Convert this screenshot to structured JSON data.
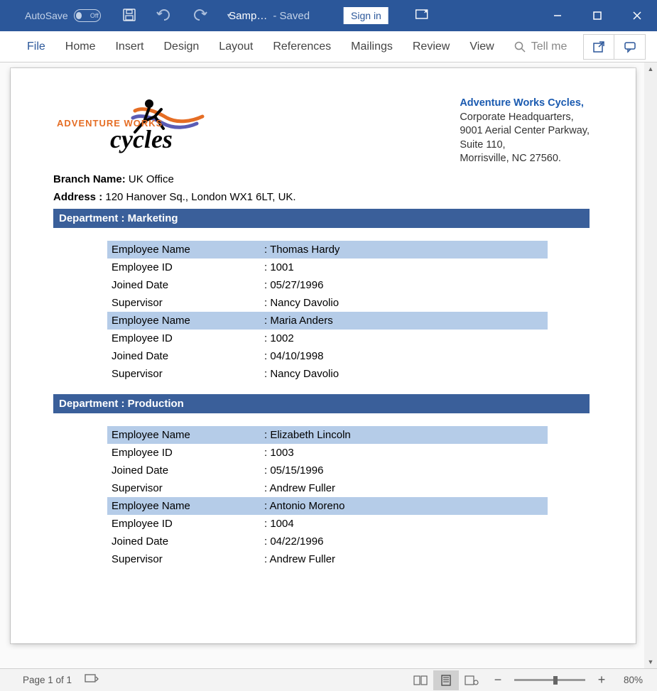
{
  "titlebar": {
    "autosave_label": "AutoSave",
    "autosave_toggle_text": "Off",
    "doc_title": "Samp…",
    "doc_status": "- Saved",
    "signin_label": "Sign in"
  },
  "ribbon": {
    "tabs": {
      "file": "File",
      "home": "Home",
      "insert": "Insert",
      "design": "Design",
      "layout": "Layout",
      "references": "References",
      "mailings": "Mailings",
      "review": "Review",
      "view": "View"
    },
    "tellme_placeholder": "Tell me"
  },
  "document": {
    "company_name": "Adventure Works Cycles,",
    "hq_line1": "Corporate Headquarters,",
    "hq_line2": "9001 Aerial Center Parkway,",
    "hq_line3": "Suite 110,",
    "hq_line4": "Morrisville, NC 27560.",
    "logo_line1": "ADVENTURE WORKS",
    "logo_line2": "cycles",
    "branch_label": "Branch Name:",
    "branch_value": "  UK Office",
    "address_label": "Address :",
    "address_value": " 120 Hanover Sq., London  WX1 6LT, UK.",
    "field_labels": {
      "emp_name": "Employee Name",
      "emp_id": "Employee ID",
      "joined": "Joined Date",
      "supervisor": "Supervisor"
    },
    "departments": [
      {
        "header": "Department : Marketing",
        "employees": [
          {
            "name": ": Thomas Hardy",
            "id": ": 1001",
            "joined": ": 05/27/1996",
            "supervisor": ": Nancy Davolio"
          },
          {
            "name": ": Maria Anders",
            "id": ": 1002",
            "joined": ": 04/10/1998",
            "supervisor": ": Nancy Davolio"
          }
        ]
      },
      {
        "header": "Department : Production",
        "employees": [
          {
            "name": ": Elizabeth Lincoln",
            "id": ": 1003",
            "joined": ": 05/15/1996",
            "supervisor": ": Andrew Fuller"
          },
          {
            "name": ": Antonio Moreno",
            "id": ": 1004",
            "joined": ": 04/22/1996",
            "supervisor": ": Andrew Fuller"
          }
        ]
      }
    ]
  },
  "statusbar": {
    "page_info": "Page 1 of 1",
    "zoom_pct": "80%"
  }
}
